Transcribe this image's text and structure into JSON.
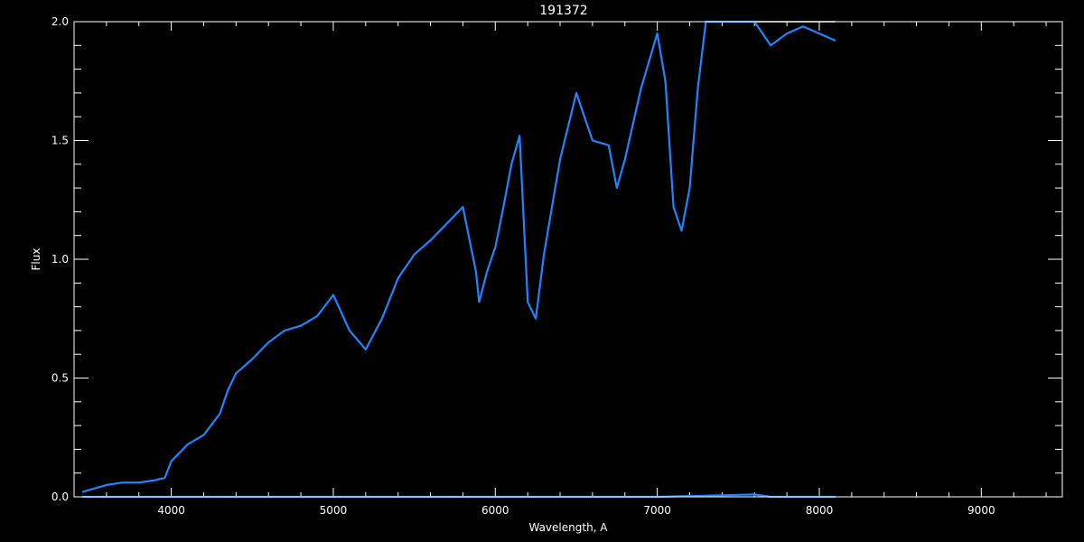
{
  "chart_data": {
    "type": "line",
    "title": "191372",
    "xlabel": "Wavelength, A",
    "ylabel": "Flux",
    "xlim": [
      3400,
      9500
    ],
    "ylim": [
      0,
      2
    ],
    "x_ticks": [
      4000,
      5000,
      6000,
      7000,
      8000,
      9000
    ],
    "y_ticks": [
      0.0,
      0.5,
      1.0,
      1.5,
      2.0
    ],
    "x_tick_labels": [
      "4000",
      "5000",
      "6000",
      "7000",
      "8000",
      "9000"
    ],
    "y_tick_labels": [
      "0.0",
      "0.5",
      "1.0",
      "1.5",
      "2.0"
    ],
    "grid": false,
    "background": "#000000",
    "axis_color": "#ffffff",
    "series": [
      {
        "color": "#ffffff",
        "x": [
          3450,
          3500,
          3600,
          3700,
          3800,
          3900,
          3960,
          4000,
          4100,
          4200,
          4300,
          4350,
          4400,
          4500,
          4600,
          4700,
          4800,
          4900,
          5000,
          5100,
          5200,
          5300,
          5400,
          5500,
          5600,
          5700,
          5800,
          5850,
          5880,
          5900,
          5950,
          6000,
          6050,
          6100,
          6150,
          6200,
          6250,
          6300,
          6400,
          6500,
          6550,
          6600,
          6700,
          6750,
          6800,
          6900,
          7000,
          7050,
          7100,
          7150,
          7200,
          7250,
          7300,
          7400,
          7500,
          7600,
          7700,
          7800,
          7900,
          8000,
          8100
        ],
        "values": [
          0.02,
          0.03,
          0.05,
          0.06,
          0.06,
          0.07,
          0.08,
          0.15,
          0.22,
          0.26,
          0.35,
          0.45,
          0.52,
          0.58,
          0.65,
          0.7,
          0.72,
          0.76,
          0.85,
          0.7,
          0.62,
          0.75,
          0.92,
          1.02,
          1.08,
          1.15,
          1.22,
          1.05,
          0.95,
          0.82,
          0.95,
          1.05,
          1.22,
          1.4,
          1.52,
          0.82,
          0.75,
          1.02,
          1.42,
          1.7,
          1.6,
          1.5,
          1.48,
          1.3,
          1.42,
          1.72,
          1.95,
          1.75,
          1.22,
          1.12,
          1.3,
          1.72,
          2.0,
          2.0,
          2.0,
          2.0,
          2.0,
          2.0,
          2.0,
          2.0,
          2.0
        ]
      },
      {
        "color": "#1f85ff",
        "x": [
          3450,
          3500,
          3600,
          3700,
          3800,
          3900,
          3960,
          4000,
          4100,
          4200,
          4300,
          4350,
          4400,
          4500,
          4600,
          4700,
          4800,
          4900,
          5000,
          5100,
          5200,
          5300,
          5400,
          5500,
          5600,
          5700,
          5800,
          5850,
          5880,
          5900,
          5950,
          6000,
          6050,
          6100,
          6150,
          6200,
          6250,
          6300,
          6400,
          6500,
          6550,
          6600,
          6700,
          6750,
          6800,
          6900,
          7000,
          7050,
          7100,
          7150,
          7200,
          7250,
          7300,
          7400,
          7500,
          7600,
          7700,
          7800,
          7900,
          8000,
          8100
        ],
        "values": [
          0.02,
          0.03,
          0.05,
          0.06,
          0.06,
          0.07,
          0.08,
          0.15,
          0.22,
          0.26,
          0.35,
          0.45,
          0.52,
          0.58,
          0.65,
          0.7,
          0.72,
          0.76,
          0.85,
          0.7,
          0.62,
          0.75,
          0.92,
          1.02,
          1.08,
          1.15,
          1.22,
          1.05,
          0.95,
          0.82,
          0.95,
          1.05,
          1.22,
          1.4,
          1.52,
          0.82,
          0.75,
          1.02,
          1.42,
          1.7,
          1.6,
          1.5,
          1.48,
          1.3,
          1.42,
          1.72,
          1.95,
          1.75,
          1.22,
          1.12,
          1.3,
          1.72,
          2.0,
          2.0,
          2.0,
          2.0,
          1.9,
          1.95,
          1.98,
          1.95,
          1.92
        ]
      },
      {
        "color": "#1f85ff",
        "x": [
          3450,
          4000,
          5000,
          6000,
          7000,
          7600,
          7700,
          8100
        ],
        "values": [
          0.0,
          0.0,
          0.0,
          0.0,
          0.0,
          0.01,
          0.0,
          0.0
        ]
      }
    ]
  }
}
